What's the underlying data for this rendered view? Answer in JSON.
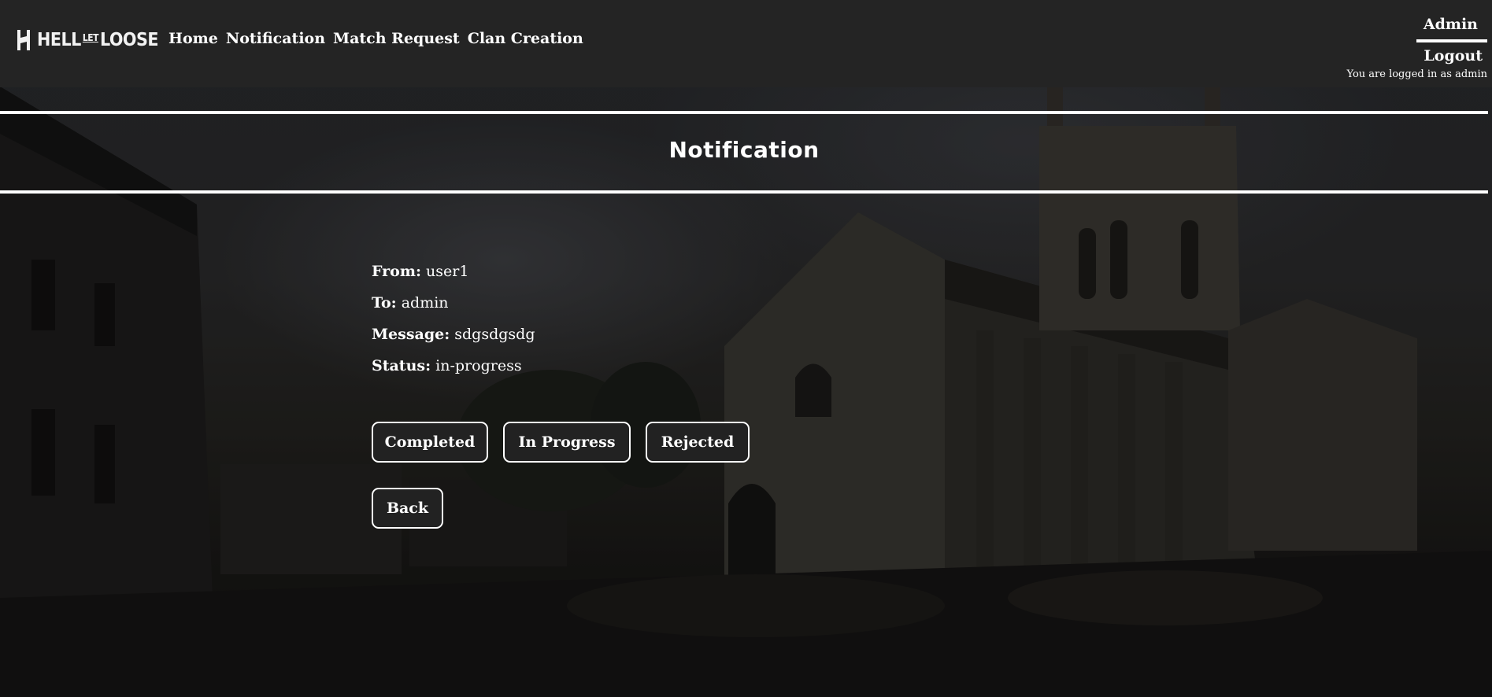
{
  "header": {
    "logo": {
      "part1": "HELL",
      "part2": "LET",
      "part3": "LOOSE"
    },
    "nav": [
      "Home",
      "Notification",
      "Match Request",
      "Clan Creation"
    ],
    "account": {
      "username": "Admin",
      "logout_label": "Logout",
      "status_text": "You are logged in as admin"
    }
  },
  "main": {
    "title": "Notification",
    "details": {
      "from_label": "From:",
      "from_value": "user1",
      "to_label": "To:",
      "to_value": "admin",
      "message_label": "Message:",
      "message_value": "sdgsdgsdg",
      "status_label": "Status:",
      "status_value": "in-progress"
    },
    "actions": {
      "completed": "Completed",
      "in_progress": "In Progress",
      "rejected": "Rejected",
      "back": "Back"
    }
  },
  "colors": {
    "header_bg": "#242424",
    "button_bg": "#222222",
    "text": "#ffffff"
  }
}
